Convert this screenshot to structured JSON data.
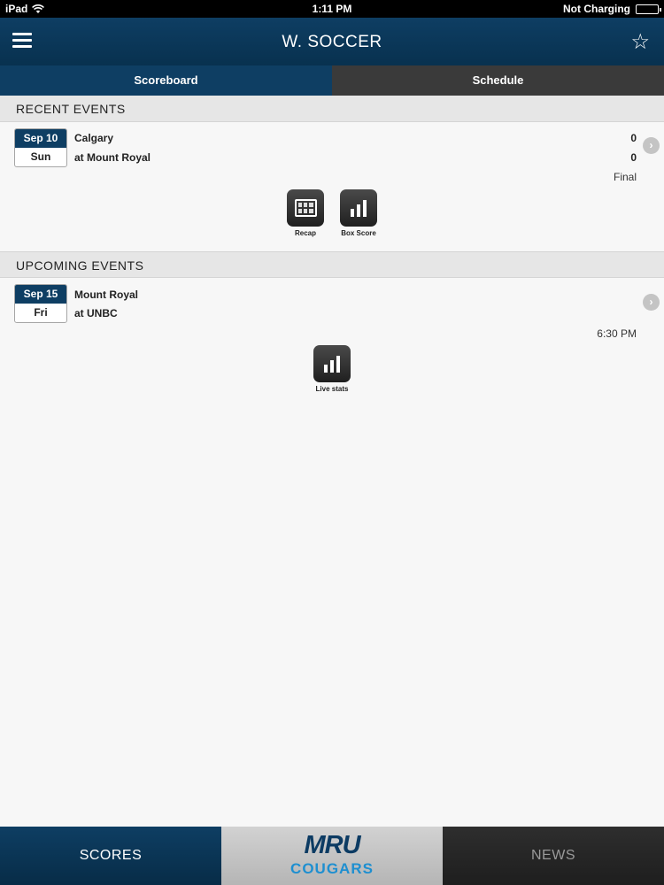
{
  "status_bar": {
    "device": "iPad",
    "time": "1:11 PM",
    "charging": "Not Charging"
  },
  "nav": {
    "title": "W. SOCCER",
    "menu_icon": "hamburger-menu-icon",
    "favorite_icon": "star-icon"
  },
  "tabs": [
    {
      "label": "Scoreboard",
      "active": true
    },
    {
      "label": "Schedule",
      "active": false
    }
  ],
  "recent": {
    "header": "RECENT EVENTS",
    "event": {
      "date": "Sep 10",
      "day": "Sun",
      "team1": "Calgary",
      "team2": "at Mount Royal",
      "score1": "0",
      "score2": "0",
      "status": "Final",
      "actions": [
        {
          "label": "Recap",
          "icon": "recap-icon"
        },
        {
          "label": "Box Score",
          "icon": "box-score-icon"
        }
      ]
    }
  },
  "upcoming": {
    "header": "UPCOMING EVENTS",
    "event": {
      "date": "Sep 15",
      "day": "Fri",
      "team1": "Mount Royal",
      "team2": "at UNBC",
      "time": "6:30 PM",
      "actions": [
        {
          "label": "Live stats",
          "icon": "live-stats-icon"
        }
      ]
    }
  },
  "bottom_bar": {
    "scores": "SCORES",
    "logo_top": "MRU",
    "logo_bottom": "COUGARS",
    "news": "NEWS"
  },
  "colors": {
    "navy": "#0e3e63",
    "dark_gray": "#3a3a3a",
    "logo_blue": "#1e8fd0"
  }
}
